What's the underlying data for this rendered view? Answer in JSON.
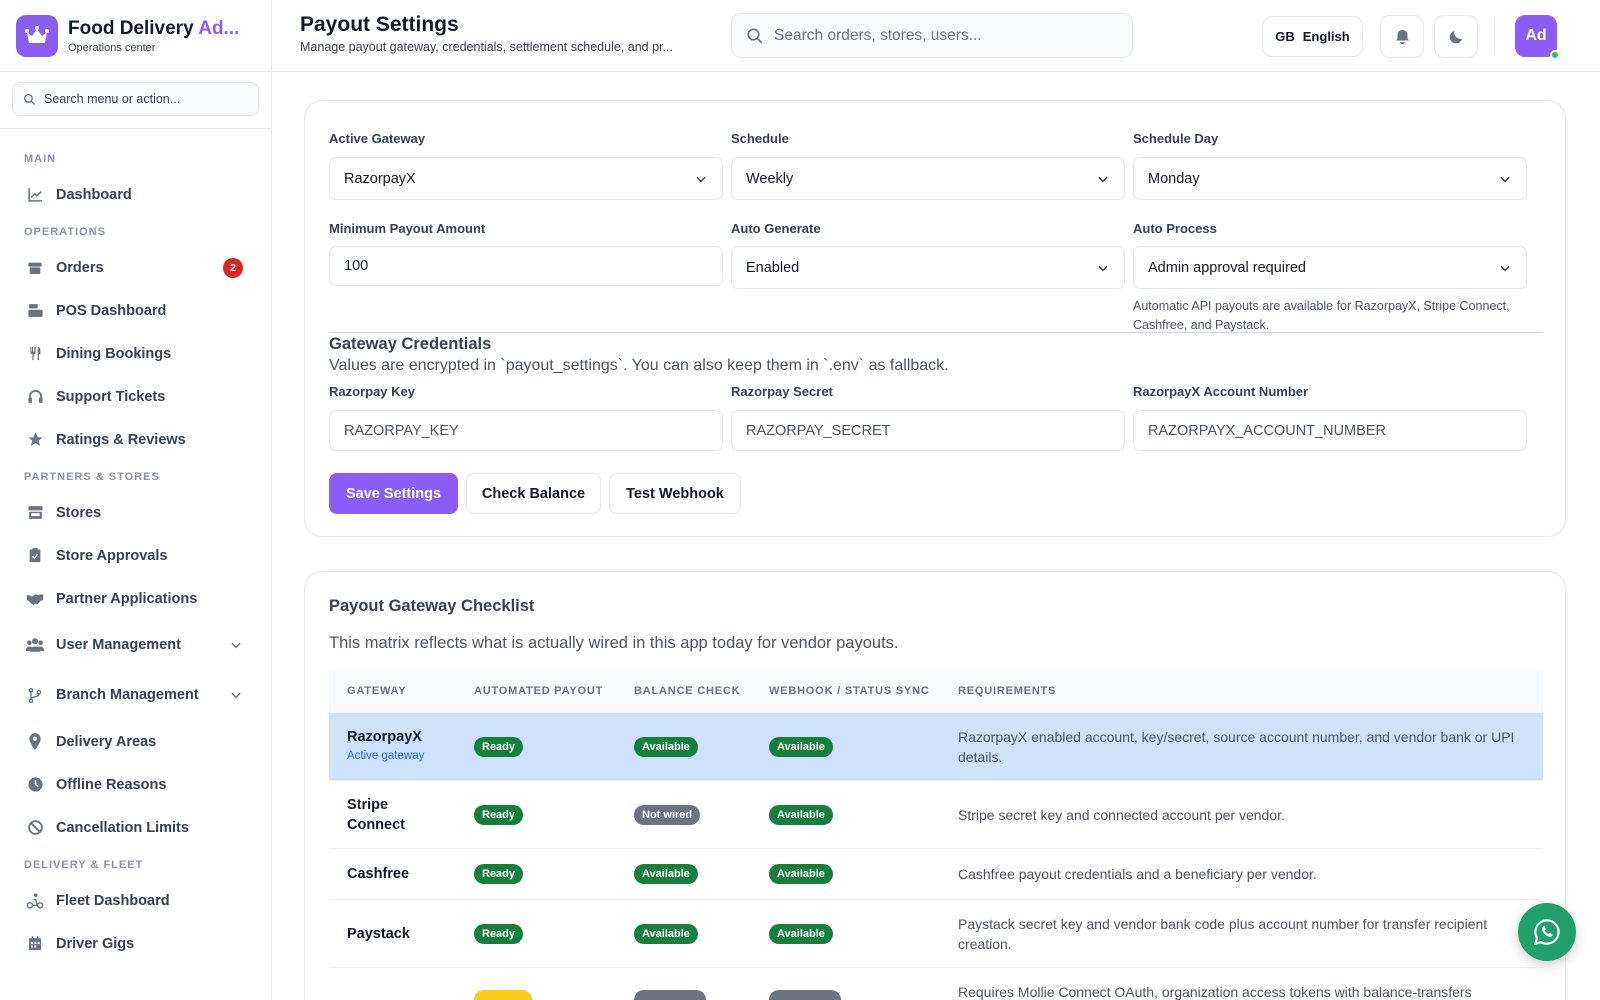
{
  "brand": {
    "title_main": "Food Delivery ",
    "title_accent": "Ad...",
    "subtitle": "Operations center"
  },
  "sidebar": {
    "search_placeholder": "Search menu or action...",
    "sections": {
      "main": "MAIN",
      "operations": "OPERATIONS",
      "partners": "PARTNERS & STORES",
      "delivery": "DELIVERY & FLEET"
    },
    "items": {
      "dashboard": "Dashboard",
      "orders": "Orders",
      "orders_badge": "2",
      "pos": "POS Dashboard",
      "dining": "Dining Bookings",
      "support": "Support Tickets",
      "ratings": "Ratings & Reviews",
      "stores": "Stores",
      "approvals": "Store Approvals",
      "partners": "Partner Applications",
      "users": "User Management",
      "branches": "Branch Management",
      "areas": "Delivery Areas",
      "offline": "Offline Reasons",
      "cancel": "Cancellation Limits",
      "fleet": "Fleet Dashboard",
      "gigs": "Driver Gigs"
    }
  },
  "header": {
    "title": "Payout Settings",
    "subtitle": "Manage payout gateway, credentials, settlement schedule, and pr...",
    "search_placeholder": "Search orders, stores, users...",
    "lang_code": "GB",
    "lang_label": "English",
    "avatar": "Ad"
  },
  "settings": {
    "active_gateway": {
      "label": "Active Gateway",
      "value": "RazorpayX"
    },
    "schedule": {
      "label": "Schedule",
      "value": "Weekly"
    },
    "schedule_day": {
      "label": "Schedule Day",
      "value": "Monday"
    },
    "min_payout": {
      "label": "Minimum Payout Amount",
      "value": "100"
    },
    "auto_generate": {
      "label": "Auto Generate",
      "value": "Enabled"
    },
    "auto_process": {
      "label": "Auto Process",
      "value": "Admin approval required"
    },
    "hint": "Automatic API payouts are available for RazorpayX, Stripe Connect, Cashfree, and Paystack.",
    "credentials_title": "Gateway Credentials",
    "credentials_desc": "Values are encrypted in `payout_settings`. You can also keep them in `.env` as fallback.",
    "razorpay_key": {
      "label": "Razorpay Key",
      "placeholder": "RAZORPAY_KEY"
    },
    "razorpay_secret": {
      "label": "Razorpay Secret",
      "placeholder": "RAZORPAY_SECRET"
    },
    "account_number": {
      "label": "RazorpayX Account Number",
      "placeholder": "RAZORPAYX_ACCOUNT_NUMBER"
    },
    "buttons": {
      "save": "Save Settings",
      "balance": "Check Balance",
      "webhook": "Test Webhook"
    }
  },
  "checklist": {
    "title": "Payout Gateway Checklist",
    "desc": "This matrix reflects what is actually wired in this app today for vendor payouts.",
    "columns": [
      "GATEWAY",
      "AUTOMATED PAYOUT",
      "BALANCE CHECK",
      "WEBHOOK / STATUS SYNC",
      "REQUIREMENTS"
    ],
    "rows": [
      {
        "gateway": "RazorpayX",
        "sub": "Active gateway",
        "payout": "Ready",
        "balance": "Available",
        "webhook": "Available",
        "req": "RazorpayX enabled account, key/secret, source account number, and vendor bank or UPI details."
      },
      {
        "gateway": "Stripe Connect",
        "payout": "Ready",
        "balance": "Not wired",
        "webhook": "Available",
        "req": "Stripe secret key and connected account per vendor."
      },
      {
        "gateway": "Cashfree",
        "payout": "Ready",
        "balance": "Available",
        "webhook": "Available",
        "req": "Cashfree payout credentials and a beneficiary per vendor."
      },
      {
        "gateway": "Paystack",
        "payout": "Ready",
        "balance": "Available",
        "webhook": "Available",
        "req": "Paystack secret key and vendor bank code plus account number for transfer recipient creation."
      },
      {
        "gateway": "",
        "payout": "",
        "balance": "",
        "webhook": "",
        "req": "Requires Mollie Connect OAuth, organization access tokens with balance-transfers"
      }
    ]
  },
  "colors": {
    "accent": "#8b5cf6",
    "ready": "#15803d",
    "not_wired": "#6b7280",
    "active_row": "#cfe2fb",
    "whatsapp": "#22a06b"
  }
}
